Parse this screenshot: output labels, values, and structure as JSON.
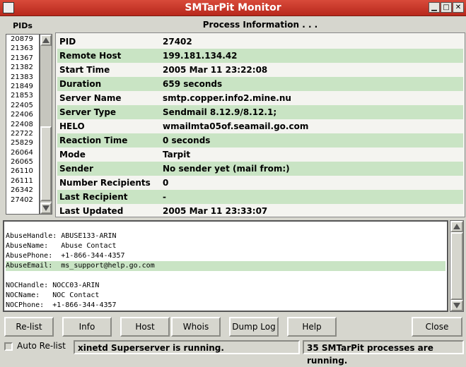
{
  "window": {
    "title": "SMTarPit Monitor"
  },
  "pids": {
    "label": "PIDs",
    "items": [
      "20879",
      "21363",
      "21367",
      "21382",
      "21383",
      "21849",
      "21853",
      "22405",
      "22406",
      "22408",
      "22722",
      "25829",
      "26064",
      "26065",
      "26110",
      "26111",
      "26342",
      "27402"
    ]
  },
  "process_info": {
    "title": "Process Information . . .",
    "rows": [
      {
        "key": "PID",
        "value": "27402"
      },
      {
        "key": "Remote Host",
        "value": "199.181.134.42"
      },
      {
        "key": "Start Time",
        "value": "2005 Mar 11 23:22:08"
      },
      {
        "key": "Duration",
        "value": "659 seconds"
      },
      {
        "key": "Server Name",
        "value": "smtp.copper.info2.mine.nu"
      },
      {
        "key": "Server Type",
        "value": "Sendmail 8.12.9/8.12.1;"
      },
      {
        "key": "HELO",
        "value": "wmailmta05of.seamail.go.com"
      },
      {
        "key": "Reaction Time",
        "value": "0 seconds"
      },
      {
        "key": "Mode",
        "value": "Tarpit"
      },
      {
        "key": "Sender",
        "value": "No sender yet (mail from:)"
      },
      {
        "key": "Number Recipients",
        "value": "0"
      },
      {
        "key": "Last Recipient",
        "value": "-"
      },
      {
        "key": "Last Updated",
        "value": "2005 Mar 11 23:33:07"
      }
    ]
  },
  "whois": {
    "lines": [
      "",
      "AbuseHandle: ABUSE133-ARIN",
      "AbuseName:   Abuse Contact",
      "AbusePhone:  +1-866-344-4357",
      "AbuseEmail:  ms_support@help.go.com",
      "",
      "NOCHandle: NOCC03-ARIN",
      "NOCName:   NOC Contact",
      "NOCPhone:  +1-866-344-4357"
    ],
    "highlighted_index": 4
  },
  "buttons": {
    "relist": "Re-list",
    "info": "Info",
    "host": "Host",
    "whois": "Whois",
    "dumplog": "Dump Log",
    "help": "Help",
    "close": "Close"
  },
  "status": {
    "auto_relist_label": "Auto Re-list",
    "auto_relist_checked": false,
    "left": "xinetd Superserver is running.",
    "right": "35 SMTarPit processes are running."
  },
  "colors": {
    "title_bar": "#c8342a",
    "row_highlight": "#c9e4c4"
  }
}
